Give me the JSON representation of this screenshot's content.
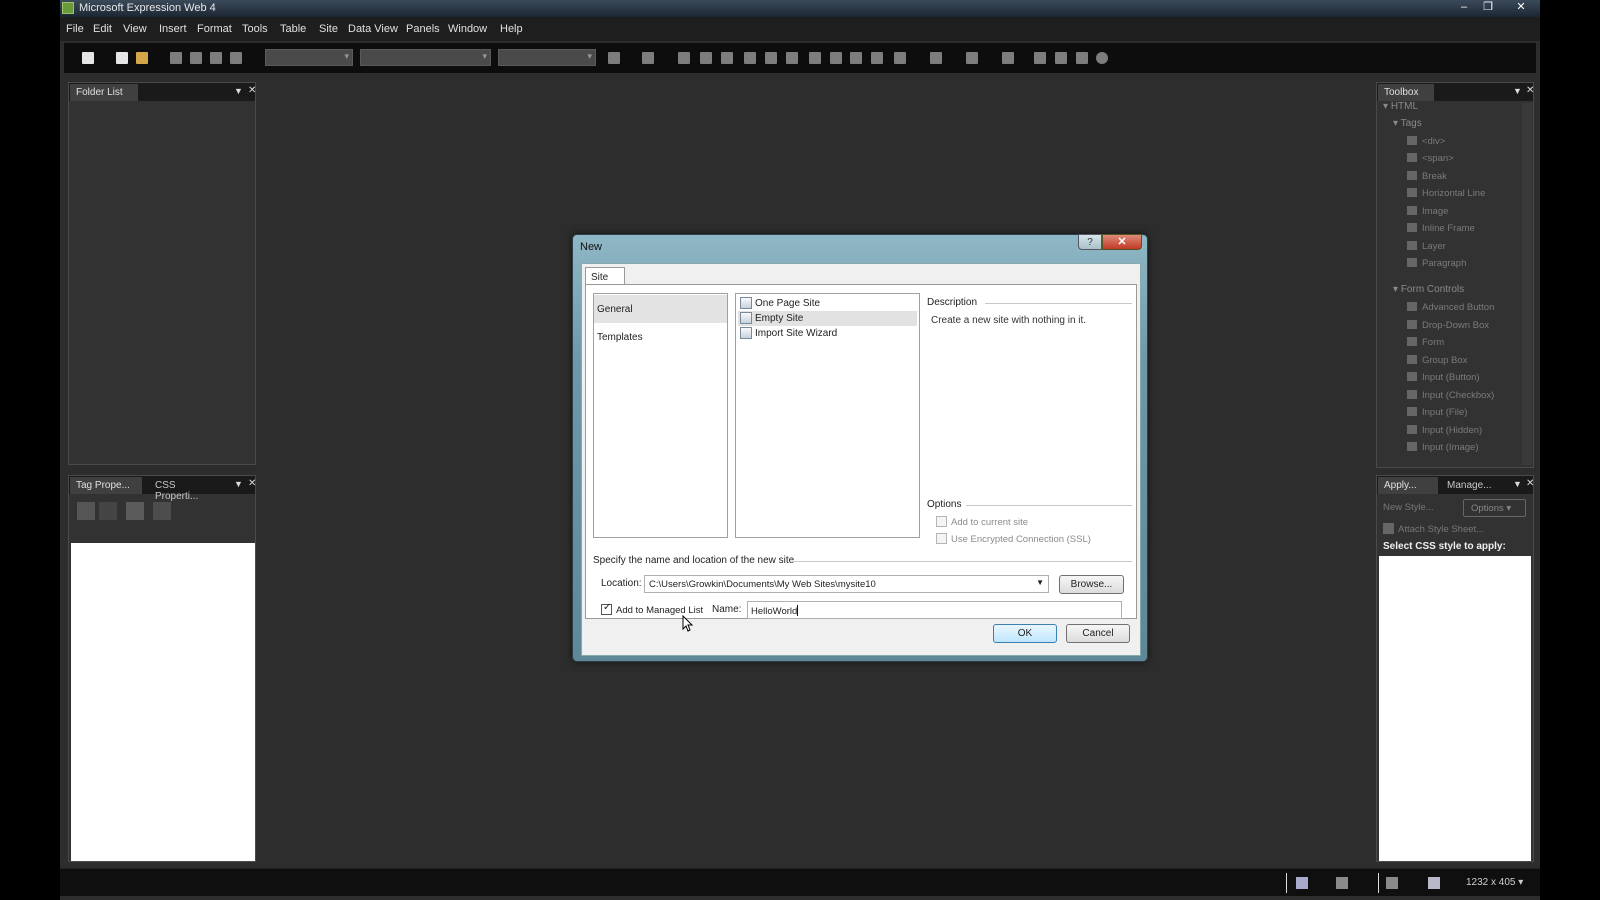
{
  "window": {
    "title": "Microsoft Expression Web 4",
    "min_glyph": "‒",
    "max_glyph": "❐",
    "close_glyph": "✕"
  },
  "menu": [
    "File",
    "Edit",
    "View",
    "Insert",
    "Format",
    "Tools",
    "Table",
    "Site",
    "Data View",
    "Panels",
    "Window",
    "Help"
  ],
  "folder_panel": {
    "tab": "Folder List"
  },
  "tag_panel": {
    "tabs": [
      "Tag Prope...",
      "CSS Properti..."
    ]
  },
  "toolbox": {
    "tab": "Toolbox",
    "root": "HTML",
    "tags_group": "Tags",
    "tags": [
      "<div>",
      "<span>",
      "Break",
      "Horizontal Line",
      "Image",
      "Inline Frame",
      "Layer",
      "Paragraph"
    ],
    "form_group": "Form Controls",
    "form_controls": [
      "Advanced Button",
      "Drop-Down Box",
      "Form",
      "Group Box",
      "Input (Button)",
      "Input (Checkbox)",
      "Input (File)",
      "Input (Hidden)",
      "Input (Image)"
    ]
  },
  "apply_panel": {
    "tabs": [
      "Apply...",
      "Manage..."
    ],
    "new_style": "New Style...",
    "options": "Options",
    "attach": "Attach Style Sheet...",
    "select_label": "Select CSS style to apply:"
  },
  "dialog": {
    "title": "New",
    "help": "?",
    "close": "✕",
    "tab": "Site",
    "categories": [
      "General",
      "Templates"
    ],
    "templates": [
      "One Page Site",
      "Empty Site",
      "Import Site Wizard"
    ],
    "description_label": "Description",
    "description_text": "Create a new site with nothing in it.",
    "options_label": "Options",
    "option_add_current": "Add to current site",
    "option_ssl": "Use Encrypted Connection (SSL)",
    "specify_label": "Specify the name and location of the new site",
    "location_label": "Location:",
    "location_value": "C:\\Users\\Growkin\\Documents\\My Web Sites\\mysite10",
    "browse_label": "Browse...",
    "managed_label": "Add to Managed List",
    "managed_checked": true,
    "name_label": "Name:",
    "name_value": "HelloWorld",
    "ok_label": "OK",
    "cancel_label": "Cancel"
  },
  "status": {
    "size": "1232 x 405 ▾"
  }
}
